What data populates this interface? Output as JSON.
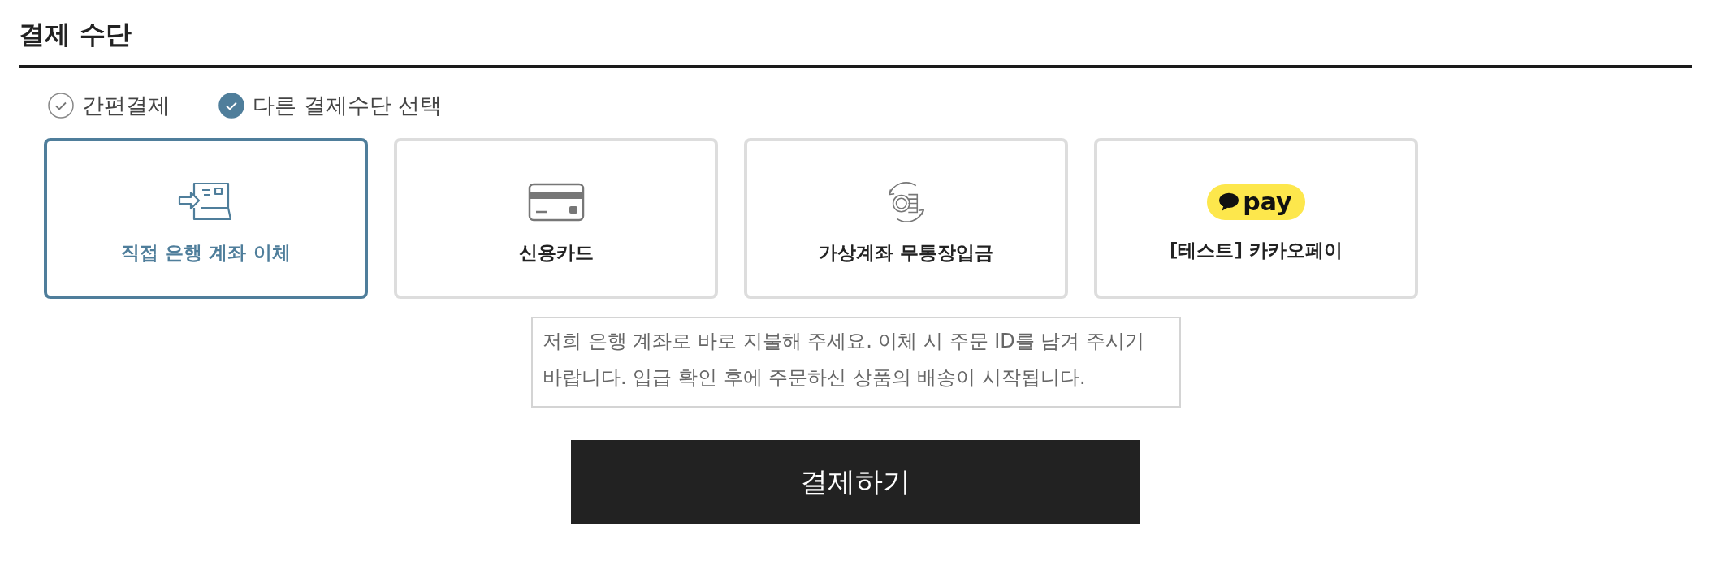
{
  "section": {
    "title": "결제 수단"
  },
  "modes": [
    {
      "label": "간편결제",
      "selected": false
    },
    {
      "label": "다른 결제수단 선택",
      "selected": true
    }
  ],
  "methods": [
    {
      "kind": "bank",
      "label": "직접 은행 계좌 이체",
      "selected": true
    },
    {
      "kind": "card",
      "label": "신용카드",
      "selected": false
    },
    {
      "kind": "virtual",
      "label": "가상계좌 무통장입금",
      "selected": false
    },
    {
      "kind": "kakao",
      "label": "[테스트] 카카오페이",
      "logo_text": "pay",
      "selected": false
    }
  ],
  "description": "저희 은행 계좌로 바로 지불해 주세요. 이체 시 주문 ID를 남겨 주시기 바랍니다. 입급 확인 후에 주문하신 상품의 배송이 시작됩니다.",
  "submit": {
    "label": "결제하기"
  }
}
